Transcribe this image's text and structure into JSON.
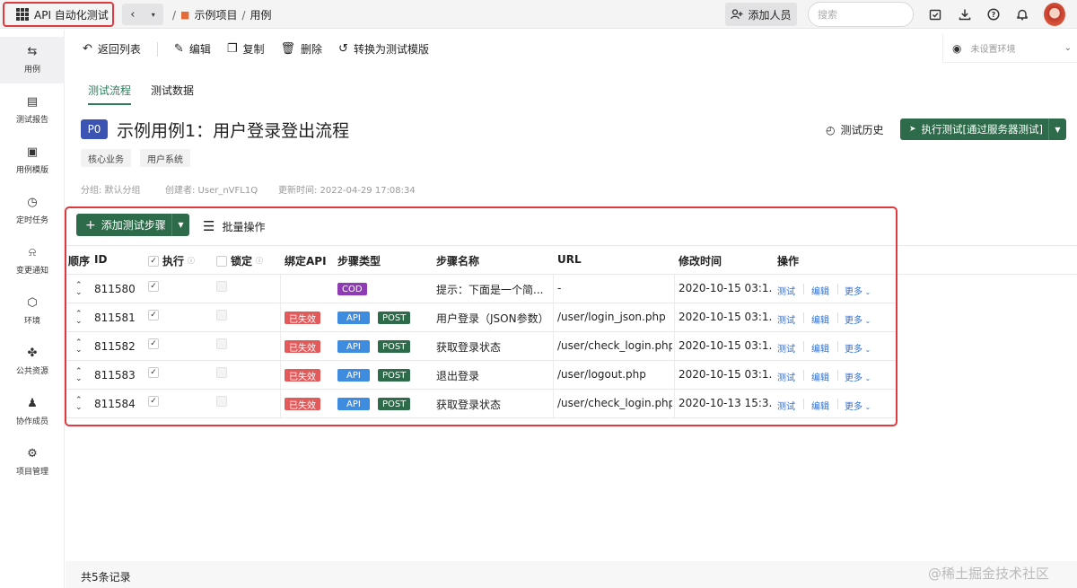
{
  "app": {
    "title": "API 自动化测试"
  },
  "breadcrumb": {
    "project": "示例项目",
    "section": "用例"
  },
  "header": {
    "add_member": "添加人员",
    "search_placeholder": "搜索"
  },
  "sidebar": {
    "items": [
      {
        "label": "用例",
        "icon": "swap-icon"
      },
      {
        "label": "测试报告",
        "icon": "report-icon"
      },
      {
        "label": "用例模版",
        "icon": "template-icon"
      },
      {
        "label": "定时任务",
        "icon": "clock-icon"
      },
      {
        "label": "变更通知",
        "icon": "bell-icon"
      },
      {
        "label": "环境",
        "icon": "cube-icon"
      },
      {
        "label": "公共资源",
        "icon": "puzzle-icon"
      },
      {
        "label": "协作成员",
        "icon": "users-icon"
      },
      {
        "label": "项目管理",
        "icon": "settings-icon"
      }
    ]
  },
  "toolbar": {
    "back": "返回列表",
    "edit": "编辑",
    "copy": "复制",
    "delete": "删除",
    "to_template": "转换为测试模版"
  },
  "env": {
    "value": "未设置环境"
  },
  "tabs": [
    {
      "label": "测试流程"
    },
    {
      "label": "测试数据"
    }
  ],
  "case": {
    "priority": "P0",
    "title": "示例用例1：用户登录登出流程",
    "history": "测试历史",
    "run": "执行测试[通过服务器测试]",
    "tags": [
      "核心业务",
      "用户系统"
    ],
    "group": "分组: 默认分组",
    "creator": "创建者: User_nVFL1Q",
    "updated": "更新时间: 2022-04-29 17:08:34"
  },
  "steps": {
    "add": "添加测试步骤",
    "batch": "批量操作",
    "columns": {
      "order": "顺序",
      "id": "ID",
      "exec": "执行",
      "lock": "锁定",
      "bind_api": "绑定API",
      "type": "步骤类型",
      "name": "步骤名称",
      "url": "URL",
      "modified": "修改时间",
      "ops": "操作"
    },
    "rows": [
      {
        "id": "811580",
        "bind": "",
        "type": "COD",
        "method": "",
        "name": "提示：下面是一个简...",
        "url": "-",
        "modified": "2020-10-15 03:1..."
      },
      {
        "id": "811581",
        "bind": "已失效",
        "type": "API",
        "method": "POST",
        "name": "用户登录（JSON参数）",
        "url": "/user/login_json.php",
        "modified": "2020-10-15 03:1..."
      },
      {
        "id": "811582",
        "bind": "已失效",
        "type": "API",
        "method": "POST",
        "name": "获取登录状态",
        "url": "/user/check_login.php",
        "modified": "2020-10-15 03:1..."
      },
      {
        "id": "811583",
        "bind": "已失效",
        "type": "API",
        "method": "POST",
        "name": "退出登录",
        "url": "/user/logout.php",
        "modified": "2020-10-15 03:1..."
      },
      {
        "id": "811584",
        "bind": "已失效",
        "type": "API",
        "method": "POST",
        "name": "获取登录状态",
        "url": "/user/check_login.php",
        "modified": "2020-10-13 15:3..."
      }
    ],
    "op_test": "测试",
    "op_edit": "编辑",
    "op_more": "更多"
  },
  "footer": {
    "total": "共5条记录"
  },
  "watermark": "@稀土掘金技术社区",
  "colors": {
    "accent": "#2e6b4a",
    "highlight": "#e0393e",
    "priority": "#3b54b4"
  }
}
